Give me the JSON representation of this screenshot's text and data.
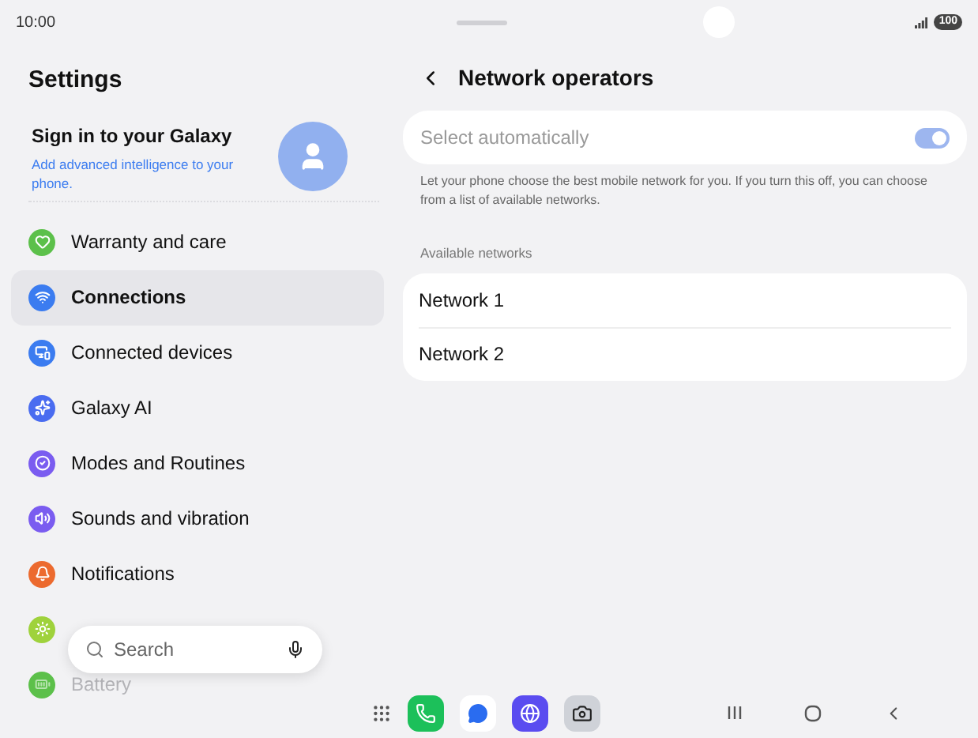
{
  "status_bar": {
    "time": "10:00",
    "battery": "100"
  },
  "sidebar": {
    "title": "Settings",
    "account": {
      "title": "Sign in to your Galaxy",
      "subtitle": "Add advanced intelligence to your phone."
    },
    "items": [
      {
        "label": "Warranty and care",
        "kind": "heart",
        "color": "#5cc04a",
        "selected": false,
        "dimmed": false
      },
      {
        "label": "Connections",
        "kind": "wifi",
        "color": "#3b7cf0",
        "selected": true,
        "dimmed": false
      },
      {
        "label": "Connected devices",
        "kind": "devices",
        "color": "#3b7cf0",
        "selected": false,
        "dimmed": false
      },
      {
        "label": "Galaxy AI",
        "kind": "sparkles",
        "color": "#4a6cf0",
        "selected": false,
        "dimmed": false
      },
      {
        "label": "Modes and Routines",
        "kind": "check",
        "color": "#7a5cf0",
        "selected": false,
        "dimmed": false
      },
      {
        "label": "Sounds and vibration",
        "kind": "sound",
        "color": "#7a5cf0",
        "selected": false,
        "dimmed": false
      },
      {
        "label": "Notifications",
        "kind": "bell",
        "color": "#ec6a2e",
        "selected": false,
        "dimmed": false
      },
      {
        "kind": "sun",
        "color": "#9fd23c",
        "selected": false,
        "dimmed": false
      },
      {
        "label": "Battery",
        "kind": "battery",
        "color": "#5cc04a",
        "selected": false,
        "dimmed": true
      }
    ],
    "search": {
      "placeholder": "Search"
    }
  },
  "page": {
    "title": "Network operators",
    "auto": {
      "label": "Select automatically",
      "on": true,
      "disabled": true
    },
    "description": "Let your phone choose the best mobile network for you. If you turn this off, you can choose from a list of available networks.",
    "section": "Available networks",
    "networks": [
      "Network 1",
      "Network 2"
    ]
  },
  "taskbar": {
    "apps": [
      {
        "kind": "phone"
      },
      {
        "kind": "messages"
      },
      {
        "kind": "internet"
      },
      {
        "kind": "camera"
      }
    ]
  }
}
